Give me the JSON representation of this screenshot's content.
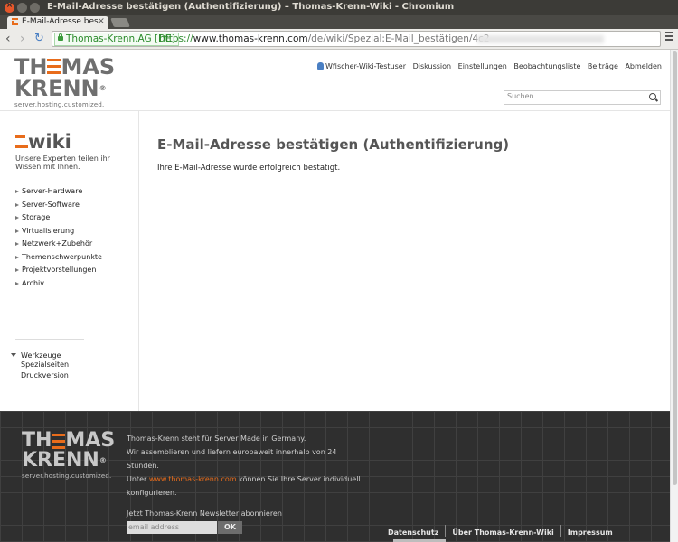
{
  "window": {
    "title": "E-Mail-Adresse bestätigen (Authentifizierung) – Thomas-Krenn-Wiki - Chromium"
  },
  "tab": {
    "label": "E-Mail-Adresse bestätigen",
    "close": "×"
  },
  "toolbar": {
    "ev_label": "Thomas-Krenn.AG [DE]",
    "url_scheme": "https://",
    "url_host": "www.thomas-krenn.com",
    "url_path": "/de/wiki/Spezial:E-Mail_bestätigen/4c2",
    "star": "☆"
  },
  "header": {
    "logo_line1": "TH",
    "logo_line1b": "MAS",
    "logo_line2": "KRENN",
    "logo_reg": "®",
    "logo_tagline": "server.hosting.customized.",
    "user_nav": [
      "Wfischer-Wiki-Testuser",
      "Diskussion",
      "Einstellungen",
      "Beobachtungsliste",
      "Beiträge",
      "Abmelden"
    ],
    "search_placeholder": "Suchen"
  },
  "sidebar": {
    "wiki_logo": "wiki",
    "wiki_tagline": "Unsere Experten teilen ihr Wissen mit Ihnen.",
    "nav": [
      "Server-Hardware",
      "Server-Software",
      "Storage",
      "Virtualisierung",
      "Netzwerk+Zubehör",
      "Themenschwerpunkte",
      "Projektvorstellungen",
      "Archiv"
    ],
    "tools_label": "Werkzeuge",
    "tools": [
      "Spezialseiten",
      "Druckversion"
    ]
  },
  "content": {
    "title": "E-Mail-Adresse bestätigen (Authentifizierung)",
    "message": "Ihre E-Mail-Adresse wurde erfolgreich bestätigt."
  },
  "footer": {
    "logo_tagline": "server.hosting.customized.",
    "line1": "Thomas-Krenn steht für Server Made in Germany.",
    "line2": "Wir assemblieren und liefern europaweit innerhalb von 24 Stunden.",
    "line3_pre": "Unter ",
    "line3_link": "www.thomas-krenn.com",
    "line3_post": " können Sie Ihre Server individuell",
    "line4": "konfigurieren.",
    "newsletter": "Jetzt Thomas-Krenn Newsletter abonnieren",
    "email_placeholder": "email address",
    "ok": "OK",
    "links": [
      "Datenschutz",
      "Über Thomas-Krenn-Wiki",
      "Impressum"
    ]
  },
  "colors": {
    "accent": "#e86c1b",
    "footer_bg": "#2f2f2f",
    "ev_green": "#2a8a2a"
  }
}
